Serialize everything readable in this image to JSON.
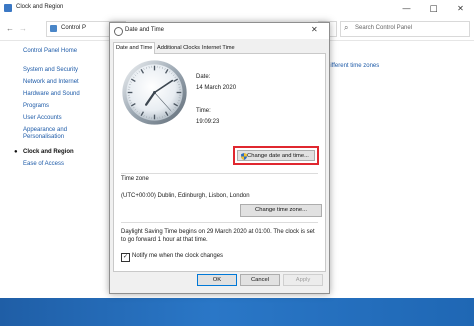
{
  "window": {
    "title": "Clock and Region",
    "minimize": "—",
    "maximize": "☐",
    "close": "✕"
  },
  "nav": {
    "back": "←",
    "forward": "→",
    "dropdown": "˅",
    "up": "↑",
    "address": "Control P",
    "refresh": "↻",
    "search_icon": "⌕",
    "search_placeholder": "Search Control Panel"
  },
  "sidebar": {
    "home": "Control Panel Home",
    "items": [
      {
        "label": "System and Security"
      },
      {
        "label": "Network and Internet"
      },
      {
        "label": "Hardware and Sound"
      },
      {
        "label": "Programs"
      },
      {
        "label": "User Accounts"
      },
      {
        "label": "Appearance and Personalisation"
      },
      {
        "label": "Clock and Region",
        "current": true
      },
      {
        "label": "Ease of Access"
      }
    ],
    "bullet": "●"
  },
  "main": {
    "partial_link": "different time zones"
  },
  "dialog": {
    "title": "Date and Time",
    "close": "✕",
    "tabs": [
      {
        "label": "Date and Time",
        "active": true
      },
      {
        "label": "Additional Clocks"
      },
      {
        "label": "Internet Time"
      }
    ],
    "date_label": "Date:",
    "date_value": "14 March 2020",
    "time_label": "Time:",
    "time_value": "19:09:23",
    "clock": {
      "hours": 19,
      "minutes": 9,
      "seconds": 23
    },
    "change_datetime_button": "Change date and time...",
    "timezone_label": "Time zone",
    "timezone_value": "(UTC+00:00) Dublin, Edinburgh, Lisbon, London",
    "change_timezone_button": "Change time zone...",
    "dst_text": "Daylight Saving Time begins on 29 March 2020 at 01:00. The clock is set to go forward 1 hour at that time.",
    "notify_checked": true,
    "notify_checkmark": "✓",
    "notify_label": "Notify me when the clock changes",
    "ok_button": "OK",
    "cancel_button": "Cancel",
    "apply_button": "Apply"
  },
  "colors": {
    "highlight_border": "#e0272f",
    "link": "#1e5ba8",
    "taskbar": "#2a77c7"
  }
}
